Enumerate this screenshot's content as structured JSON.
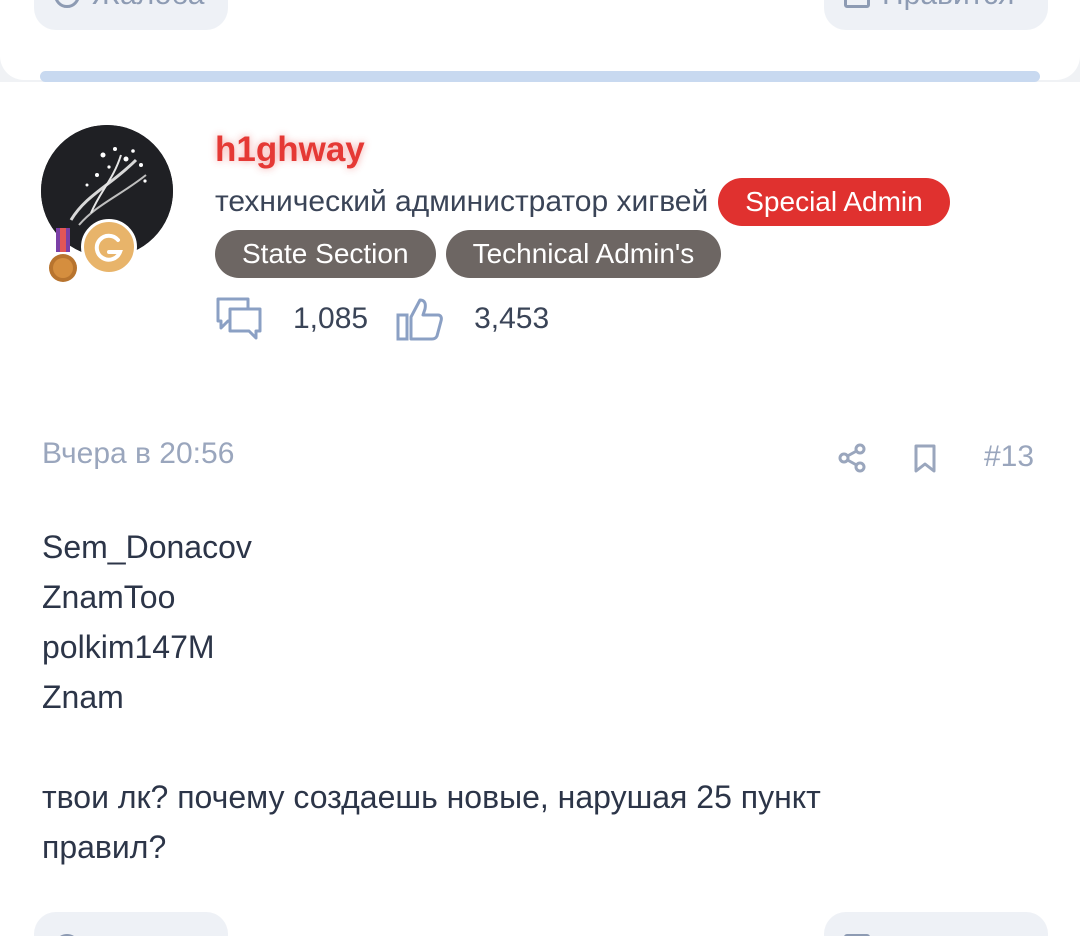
{
  "previous_post": {
    "complaint_label": "Жалоба",
    "like_label": "Нравится"
  },
  "post": {
    "author": {
      "username": "h1ghway",
      "title": "технический администратор хигвей",
      "badges": [
        "Special Admin",
        "State Section",
        "Technical Admin's"
      ],
      "messages_count": "1,085",
      "likes_count": "3,453"
    },
    "timestamp": "Вчера в 20:56",
    "post_number": "#13",
    "content_lines": [
      "Sem_Donacov",
      "ZnamToo",
      "polkim147M",
      "Znam",
      "",
      "твои лк? почему создаешь новые, нарушая 25 пункт",
      "правил?"
    ]
  },
  "colors": {
    "username": "#e53935",
    "special_badge": "#e0312f",
    "section_badge": "#6d6663",
    "meta_text": "#9aa6bd",
    "separator": "#c8d9f0"
  },
  "icons": {
    "messages": "messages-icon",
    "likes": "thumbs-up-icon",
    "share": "share-icon",
    "bookmark": "bookmark-icon"
  }
}
